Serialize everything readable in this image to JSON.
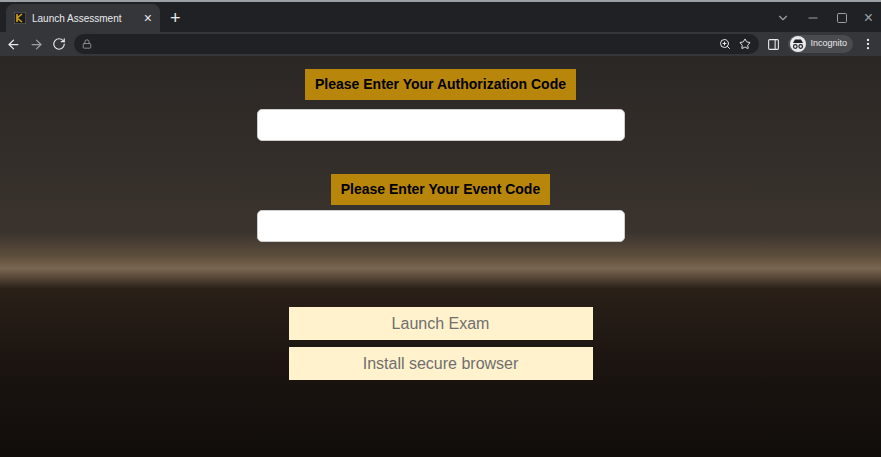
{
  "window": {
    "tab_title": "Launch Assessment",
    "tab_close": "×",
    "new_tab": "+",
    "window_close": "×"
  },
  "toolbar": {
    "profile_label": "Incognito"
  },
  "form": {
    "fields": [
      {
        "label": "Please Enter Your Authorization Code"
      },
      {
        "label": "Please Enter Your Event Code"
      }
    ],
    "buttons": [
      "Launch Exam",
      "Install secure browser"
    ]
  }
}
